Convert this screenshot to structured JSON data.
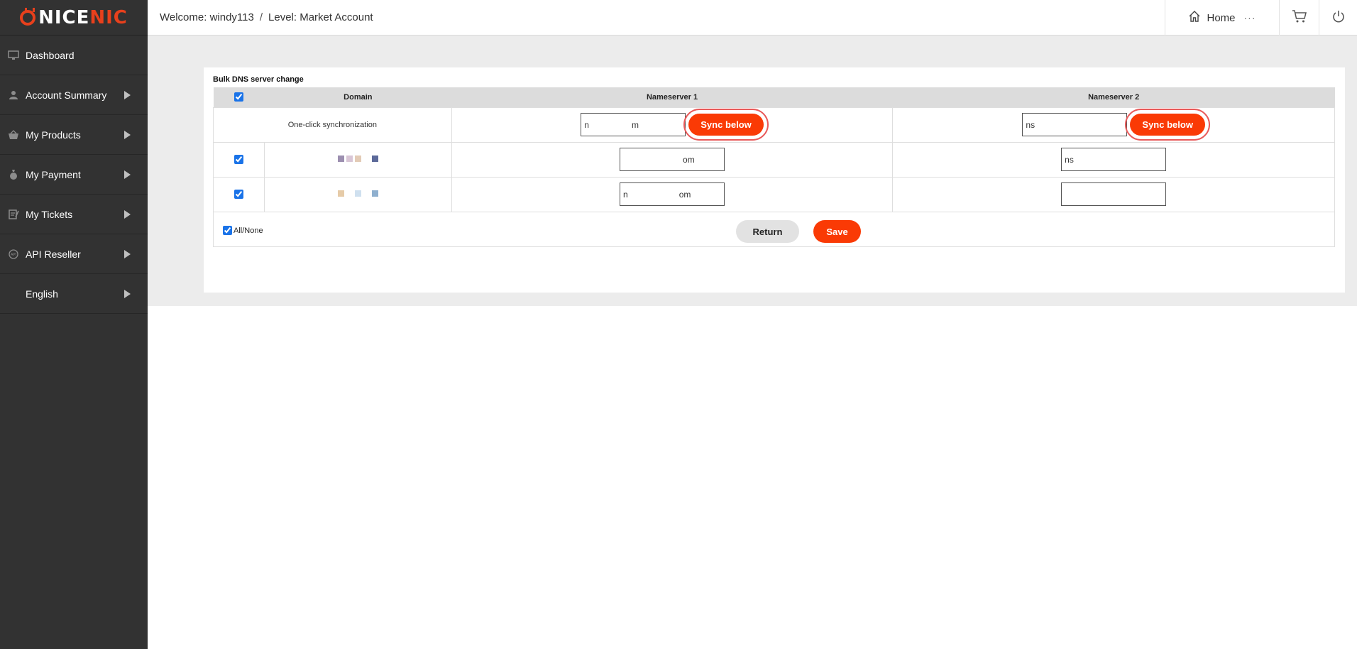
{
  "brand": {
    "logo_text_a": "NICE",
    "logo_text_b": "NIC",
    "accent": "#fa3a05"
  },
  "sidebar": {
    "items": [
      {
        "label": "Dashboard",
        "icon": "monitor-icon",
        "arrow": false
      },
      {
        "label": "Account Summary",
        "icon": "user-icon",
        "arrow": true
      },
      {
        "label": "My Products",
        "icon": "basket-icon",
        "arrow": true
      },
      {
        "label": "My Payment",
        "icon": "money-bag-icon",
        "arrow": true
      },
      {
        "label": "My Tickets",
        "icon": "ticket-icon",
        "arrow": true
      },
      {
        "label": "API Reseller",
        "icon": "api-icon",
        "arrow": true
      },
      {
        "label": "English",
        "icon": "",
        "arrow": true
      }
    ]
  },
  "header": {
    "welcome": "Welcome: windy113",
    "separator": "/",
    "level": "Level: Market Account",
    "home_label": "Home",
    "more": "···"
  },
  "bulk": {
    "title": "Bulk DNS server change",
    "columns": [
      "Domain",
      "Nameserver 1",
      "Nameserver 2"
    ],
    "sync_row": {
      "label": "One-click synchronization",
      "ns1_value": "n     m",
      "ns2_value": "ns",
      "sync_label": "Sync below"
    },
    "rows": [
      {
        "checked": true,
        "ns1_value": "       om",
        "ns2_value": "ns"
      },
      {
        "checked": true,
        "ns1_value": "n      om",
        "ns2_value": ""
      }
    ],
    "all_none_label": "All/None",
    "return_label": "Return",
    "save_label": "Save"
  }
}
